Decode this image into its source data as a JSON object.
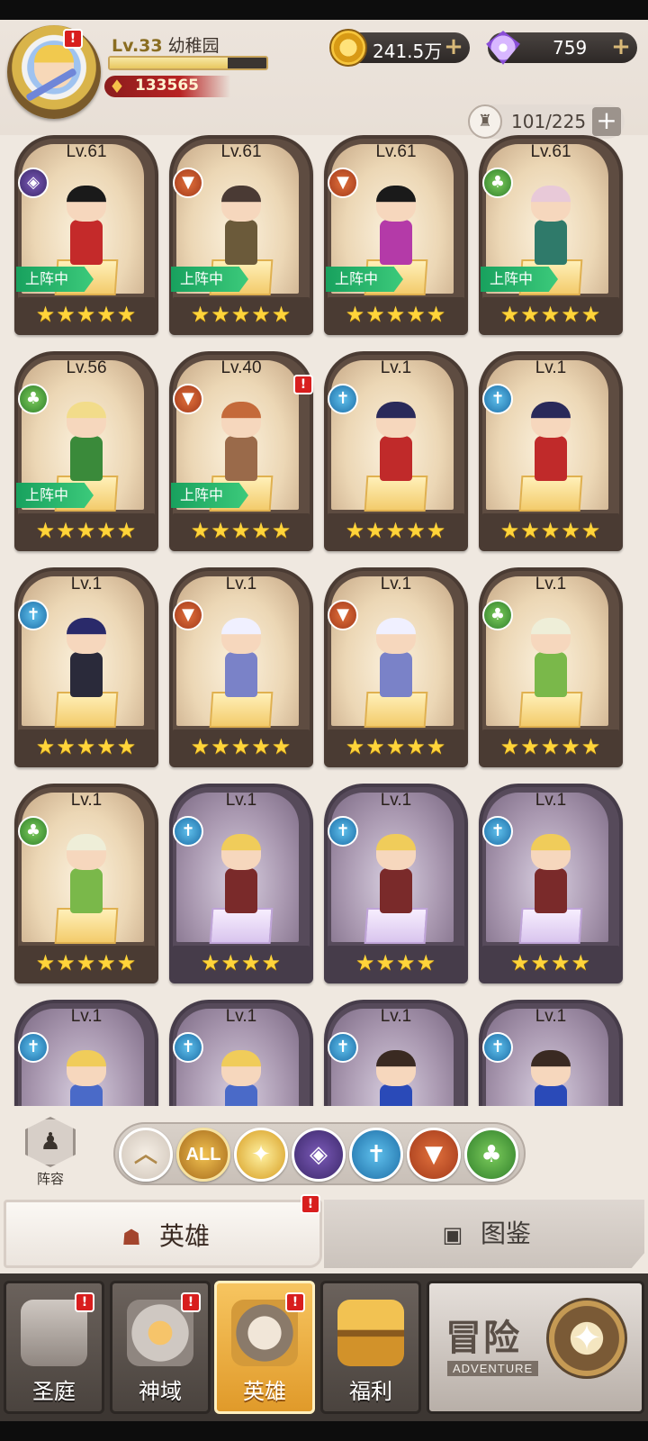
{
  "player": {
    "level": "Lv.33",
    "name": "幼稚园",
    "power": "133565",
    "xp_fraction": 0.75
  },
  "currency": {
    "gold": "241.5万",
    "diamonds": "759"
  },
  "roster": {
    "capacity": "101/225"
  },
  "heroes": [
    {
      "level": "Lv.61",
      "faction": "shadow",
      "stars": "★★★★★",
      "deployed": true,
      "alert": false,
      "hair": "#1a1a1a",
      "outfit": "#c42a2a",
      "frame": "gold"
    },
    {
      "level": "Lv.61",
      "faction": "beast",
      "stars": "★★★★★",
      "deployed": true,
      "alert": false,
      "hair": "#4a3a34",
      "outfit": "#6b5a3a",
      "frame": "gold"
    },
    {
      "level": "Lv.61",
      "faction": "beast",
      "stars": "★★★★★",
      "deployed": true,
      "alert": false,
      "hair": "#1a1a1a",
      "outfit": "#b43aa8",
      "frame": "gold"
    },
    {
      "level": "Lv.61",
      "faction": "nature",
      "stars": "★★★★★",
      "deployed": true,
      "alert": false,
      "hair": "#e8c9d8",
      "outfit": "#2f7a6a",
      "frame": "gold"
    },
    {
      "level": "Lv.56",
      "faction": "nature",
      "stars": "★★★★★",
      "deployed": true,
      "alert": false,
      "hair": "#f2dc8a",
      "outfit": "#3a8a3a",
      "frame": "gold"
    },
    {
      "level": "Lv.40",
      "faction": "beast",
      "stars": "★★★★★",
      "deployed": true,
      "alert": true,
      "hair": "#c46a3a",
      "outfit": "#9a6a4a",
      "frame": "gold"
    },
    {
      "level": "Lv.1",
      "faction": "holy",
      "stars": "★★★★★",
      "deployed": false,
      "alert": false,
      "hair": "#2a2a5a",
      "outfit": "#c02a2a",
      "frame": "gold"
    },
    {
      "level": "Lv.1",
      "faction": "holy",
      "stars": "★★★★★",
      "deployed": false,
      "alert": false,
      "hair": "#2a2a5a",
      "outfit": "#c02a2a",
      "frame": "gold"
    },
    {
      "level": "Lv.1",
      "faction": "holy",
      "stars": "★★★★★",
      "deployed": false,
      "alert": false,
      "hair": "#2a2a6a",
      "outfit": "#2a2a3a",
      "frame": "gold"
    },
    {
      "level": "Lv.1",
      "faction": "beast",
      "stars": "★★★★★",
      "deployed": false,
      "alert": false,
      "hair": "#f0f0ff",
      "outfit": "#7a82c8",
      "frame": "gold"
    },
    {
      "level": "Lv.1",
      "faction": "beast",
      "stars": "★★★★★",
      "deployed": false,
      "alert": false,
      "hair": "#f0f0ff",
      "outfit": "#7a82c8",
      "frame": "gold"
    },
    {
      "level": "Lv.1",
      "faction": "nature",
      "stars": "★★★★★",
      "deployed": false,
      "alert": false,
      "hair": "#eeeed8",
      "outfit": "#7ab84a",
      "frame": "gold"
    },
    {
      "level": "Lv.1",
      "faction": "nature",
      "stars": "★★★★★",
      "deployed": false,
      "alert": false,
      "hair": "#eeeed8",
      "outfit": "#7ab84a",
      "frame": "gold"
    },
    {
      "level": "Lv.1",
      "faction": "holy",
      "stars": "★★★★",
      "deployed": false,
      "alert": false,
      "hair": "#f0cc5a",
      "outfit": "#7a2a2a",
      "frame": "purple"
    },
    {
      "level": "Lv.1",
      "faction": "holy",
      "stars": "★★★★",
      "deployed": false,
      "alert": false,
      "hair": "#f0cc5a",
      "outfit": "#7a2a2a",
      "frame": "purple"
    },
    {
      "level": "Lv.1",
      "faction": "holy",
      "stars": "★★★★",
      "deployed": false,
      "alert": false,
      "hair": "#f0cc5a",
      "outfit": "#7a2a2a",
      "frame": "purple"
    },
    {
      "level": "Lv.1",
      "faction": "holy",
      "stars": "",
      "deployed": false,
      "alert": false,
      "hair": "#f0cc5a",
      "outfit": "#4a6ac8",
      "frame": "purple"
    },
    {
      "level": "Lv.1",
      "faction": "holy",
      "stars": "",
      "deployed": false,
      "alert": false,
      "hair": "#f0cc5a",
      "outfit": "#4a6ac8",
      "frame": "purple"
    },
    {
      "level": "Lv.1",
      "faction": "holy",
      "stars": "",
      "deployed": false,
      "alert": false,
      "hair": "#3a2a22",
      "outfit": "#2a4ab8",
      "frame": "purple"
    },
    {
      "level": "Lv.1",
      "faction": "holy",
      "stars": "",
      "deployed": false,
      "alert": false,
      "hair": "#3a2a22",
      "outfit": "#2a4ab8",
      "frame": "purple"
    }
  ],
  "labels": {
    "deployed": "上阵中",
    "formation": "阵容",
    "filter_all": "ALL"
  },
  "tabs": {
    "heroes": "英雄",
    "codex": "图鉴"
  },
  "nav": {
    "items": [
      {
        "label": "圣庭",
        "icon": "sanctuary-icon",
        "alert": true
      },
      {
        "label": "神域",
        "icon": "divine-domain-icon",
        "alert": true
      },
      {
        "label": "英雄",
        "icon": "hero-helmet-icon",
        "alert": true
      },
      {
        "label": "福利",
        "icon": "treasure-chest-icon",
        "alert": false
      }
    ],
    "adventure_title": "冒险",
    "adventure_subtitle": "ADVENTURE"
  },
  "colors": {
    "shadow": "#5a3e94",
    "beast": "#c4532a",
    "nature": "#4a9e3a",
    "holy": "#2f8ac6",
    "alert": "#d81e1e",
    "deployed": "#18a15e"
  }
}
